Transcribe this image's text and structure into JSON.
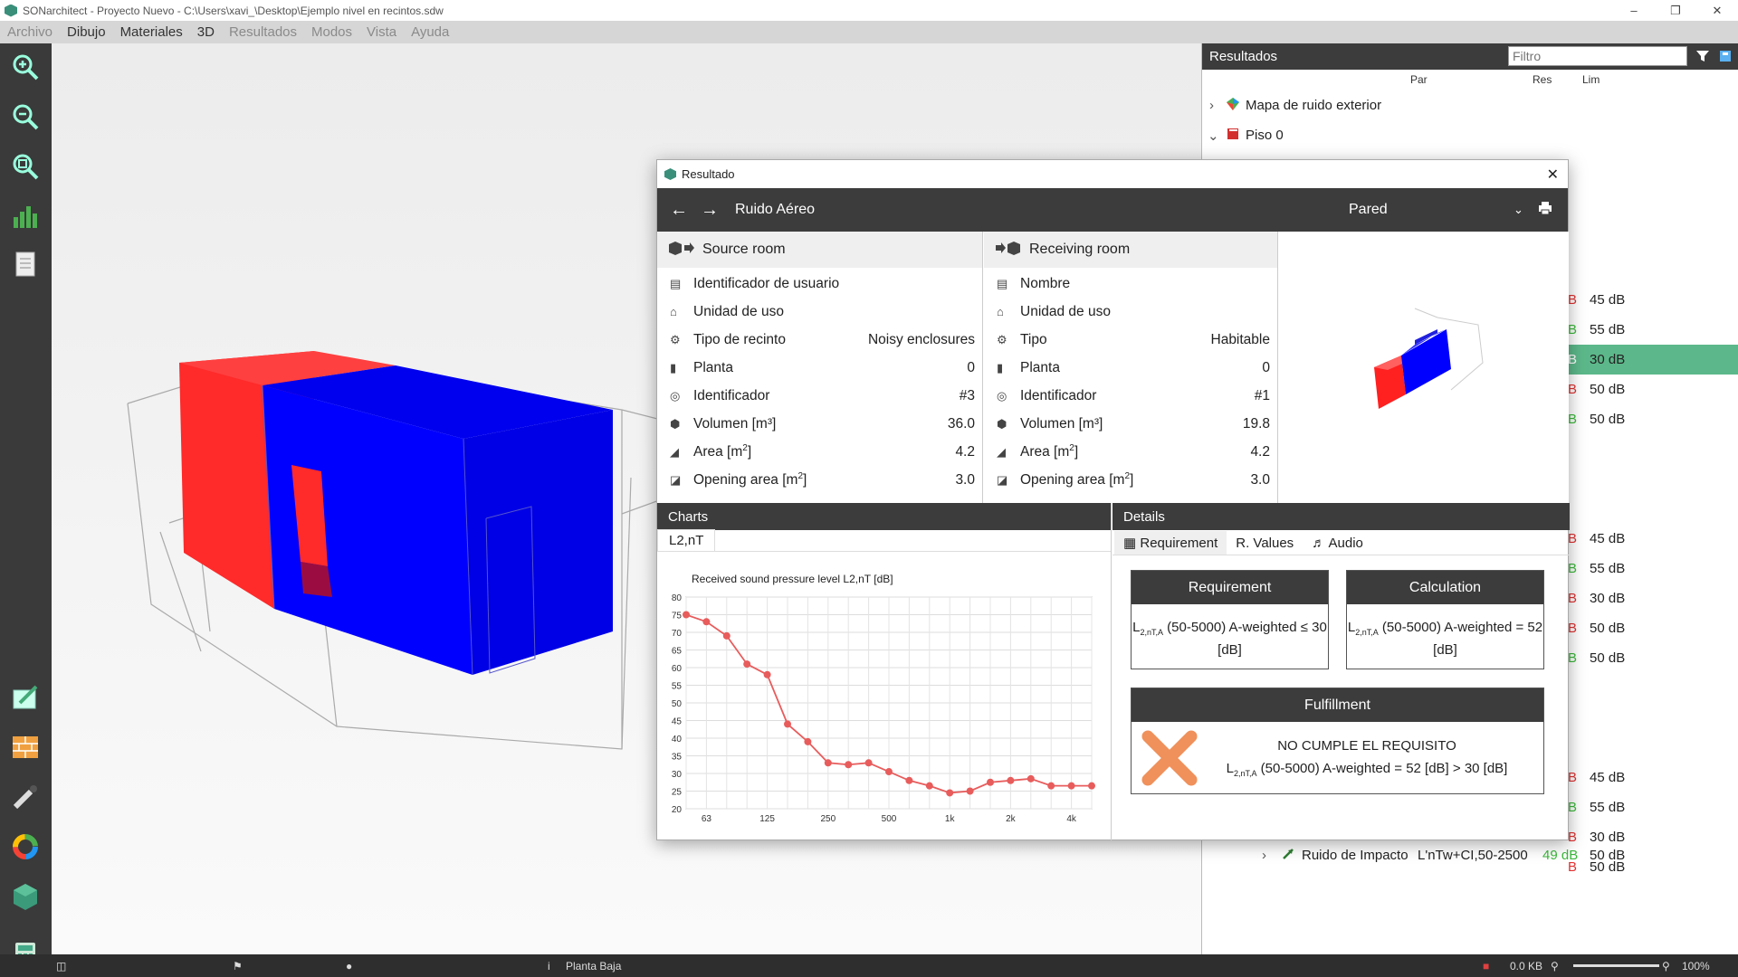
{
  "window": {
    "title": "SONarchitect - Proyecto Nuevo - C:\\Users\\xavi_\\Desktop\\Ejemplo nivel en recintos.sdw"
  },
  "menu": [
    "Archivo",
    "Dibujo",
    "Materiales",
    "3D",
    "Resultados",
    "Modos",
    "Vista",
    "Ayuda"
  ],
  "results_panel": {
    "title": "Resultados",
    "filter_placeholder": "Filtro",
    "col_par": "Par",
    "col_res": "Res",
    "col_lim": "Lim",
    "tree_top": [
      "Mapa de ruido exterior",
      "Piso 0"
    ],
    "rows": [
      {
        "res": "B",
        "lim": "45 dB",
        "res_color": "#e03030"
      },
      {
        "res": "B",
        "lim": "55 dB",
        "res_color": "#3ab83a"
      },
      {
        "res": "B",
        "lim": "30 dB",
        "res_color": "#3ab83a",
        "selected": true
      },
      {
        "res": "B",
        "lim": "50 dB",
        "res_color": "#e03030"
      },
      {
        "res": "B",
        "lim": "50 dB",
        "res_color": "#3ab83a"
      },
      {
        "res": "B",
        "lim": "45 dB",
        "res_color": "#e03030"
      },
      {
        "res": "B",
        "lim": "55 dB",
        "res_color": "#3ab83a"
      },
      {
        "res": "B",
        "lim": "30 dB",
        "res_color": "#e03030"
      },
      {
        "res": "B",
        "lim": "50 dB",
        "res_color": "#e03030"
      },
      {
        "res": "B",
        "lim": "50 dB",
        "res_color": "#3ab83a"
      },
      {
        "res": "B",
        "lim": "45 dB",
        "res_color": "#e03030"
      },
      {
        "res": "B",
        "lim": "55 dB",
        "res_color": "#3ab83a"
      },
      {
        "res": "B",
        "lim": "30 dB",
        "res_color": "#e03030"
      },
      {
        "res": "B",
        "lim": "50 dB",
        "res_color": "#e03030"
      }
    ],
    "impact_row": {
      "name": "Ruido de Impacto",
      "par": "L'nTw+CI,50-2500",
      "res": "49 dB",
      "lim": "50 dB"
    }
  },
  "dialog": {
    "title": "Resultado",
    "nav_title": "Ruido Aéreo",
    "element_select": "Pared",
    "source": {
      "header": "Source room",
      "rows": [
        {
          "label": "Identificador de usuario",
          "value": ""
        },
        {
          "label": "Unidad de uso",
          "value": ""
        },
        {
          "label": "Tipo de recinto",
          "value": "Noisy enclosures"
        },
        {
          "label": "Planta",
          "value": "0"
        },
        {
          "label": "Identificador",
          "value": "#3"
        },
        {
          "label": "Volumen [m³]",
          "value": "36.0"
        },
        {
          "label": "Area [m2]",
          "value": "4.2"
        },
        {
          "label": "Opening area [m2]",
          "value": "3.0"
        }
      ]
    },
    "receiving": {
      "header": "Receiving room",
      "rows": [
        {
          "label": "Nombre",
          "value": ""
        },
        {
          "label": "Unidad de uso",
          "value": ""
        },
        {
          "label": "Tipo",
          "value": "Habitable"
        },
        {
          "label": "Planta",
          "value": "0"
        },
        {
          "label": "Identificador",
          "value": "#1"
        },
        {
          "label": "Volumen [m³]",
          "value": "19.8"
        },
        {
          "label": "Area [m2]",
          "value": "4.2"
        },
        {
          "label": "Opening area [m2]",
          "value": "3.0"
        }
      ]
    },
    "charts": {
      "header": "Charts",
      "tab": "L2,nT"
    },
    "details": {
      "header": "Details",
      "tabs": [
        "Requirement",
        "Values",
        "Audio"
      ],
      "requirement_title": "Requirement",
      "requirement_text": "(50-5000) A-weighted ≤ 30 [dB]",
      "calculation_title": "Calculation",
      "calculation_text": "(50-5000) A-weighted = 52 [dB]",
      "fulfillment_title": "Fulfillment",
      "fulfillment_status": "NO CUMPLE EL REQUISITO",
      "fulfillment_text": "(50-5000) A-weighted = 52 [dB] > 30 [dB]"
    }
  },
  "status": {
    "floor": "Planta Baja",
    "size": "0.0 KB",
    "zoom": "100%"
  },
  "chart_data": {
    "type": "line",
    "title": "Received sound pressure level L2,nT [dB]",
    "x": [
      "50",
      "63",
      "80",
      "100",
      "125",
      "160",
      "200",
      "250",
      "315",
      "400",
      "500",
      "630",
      "800",
      "1k",
      "1.25k",
      "1.6k",
      "2k",
      "2.5k",
      "3.15k",
      "4k",
      "5k"
    ],
    "x_tick_labels": [
      "63",
      "125",
      "250",
      "500",
      "1k",
      "2k",
      "4k"
    ],
    "values": [
      75,
      73,
      69,
      61,
      58,
      44,
      39,
      33,
      32.5,
      33,
      30.5,
      28,
      26.5,
      24.5,
      25,
      27.5,
      28,
      28.5,
      26.5,
      26.5,
      26.5
    ],
    "ylim": [
      20,
      80
    ],
    "y_ticks": [
      20,
      25,
      30,
      35,
      40,
      45,
      50,
      55,
      60,
      65,
      70,
      75,
      80
    ],
    "color": "#e85c5c",
    "grid": true
  }
}
